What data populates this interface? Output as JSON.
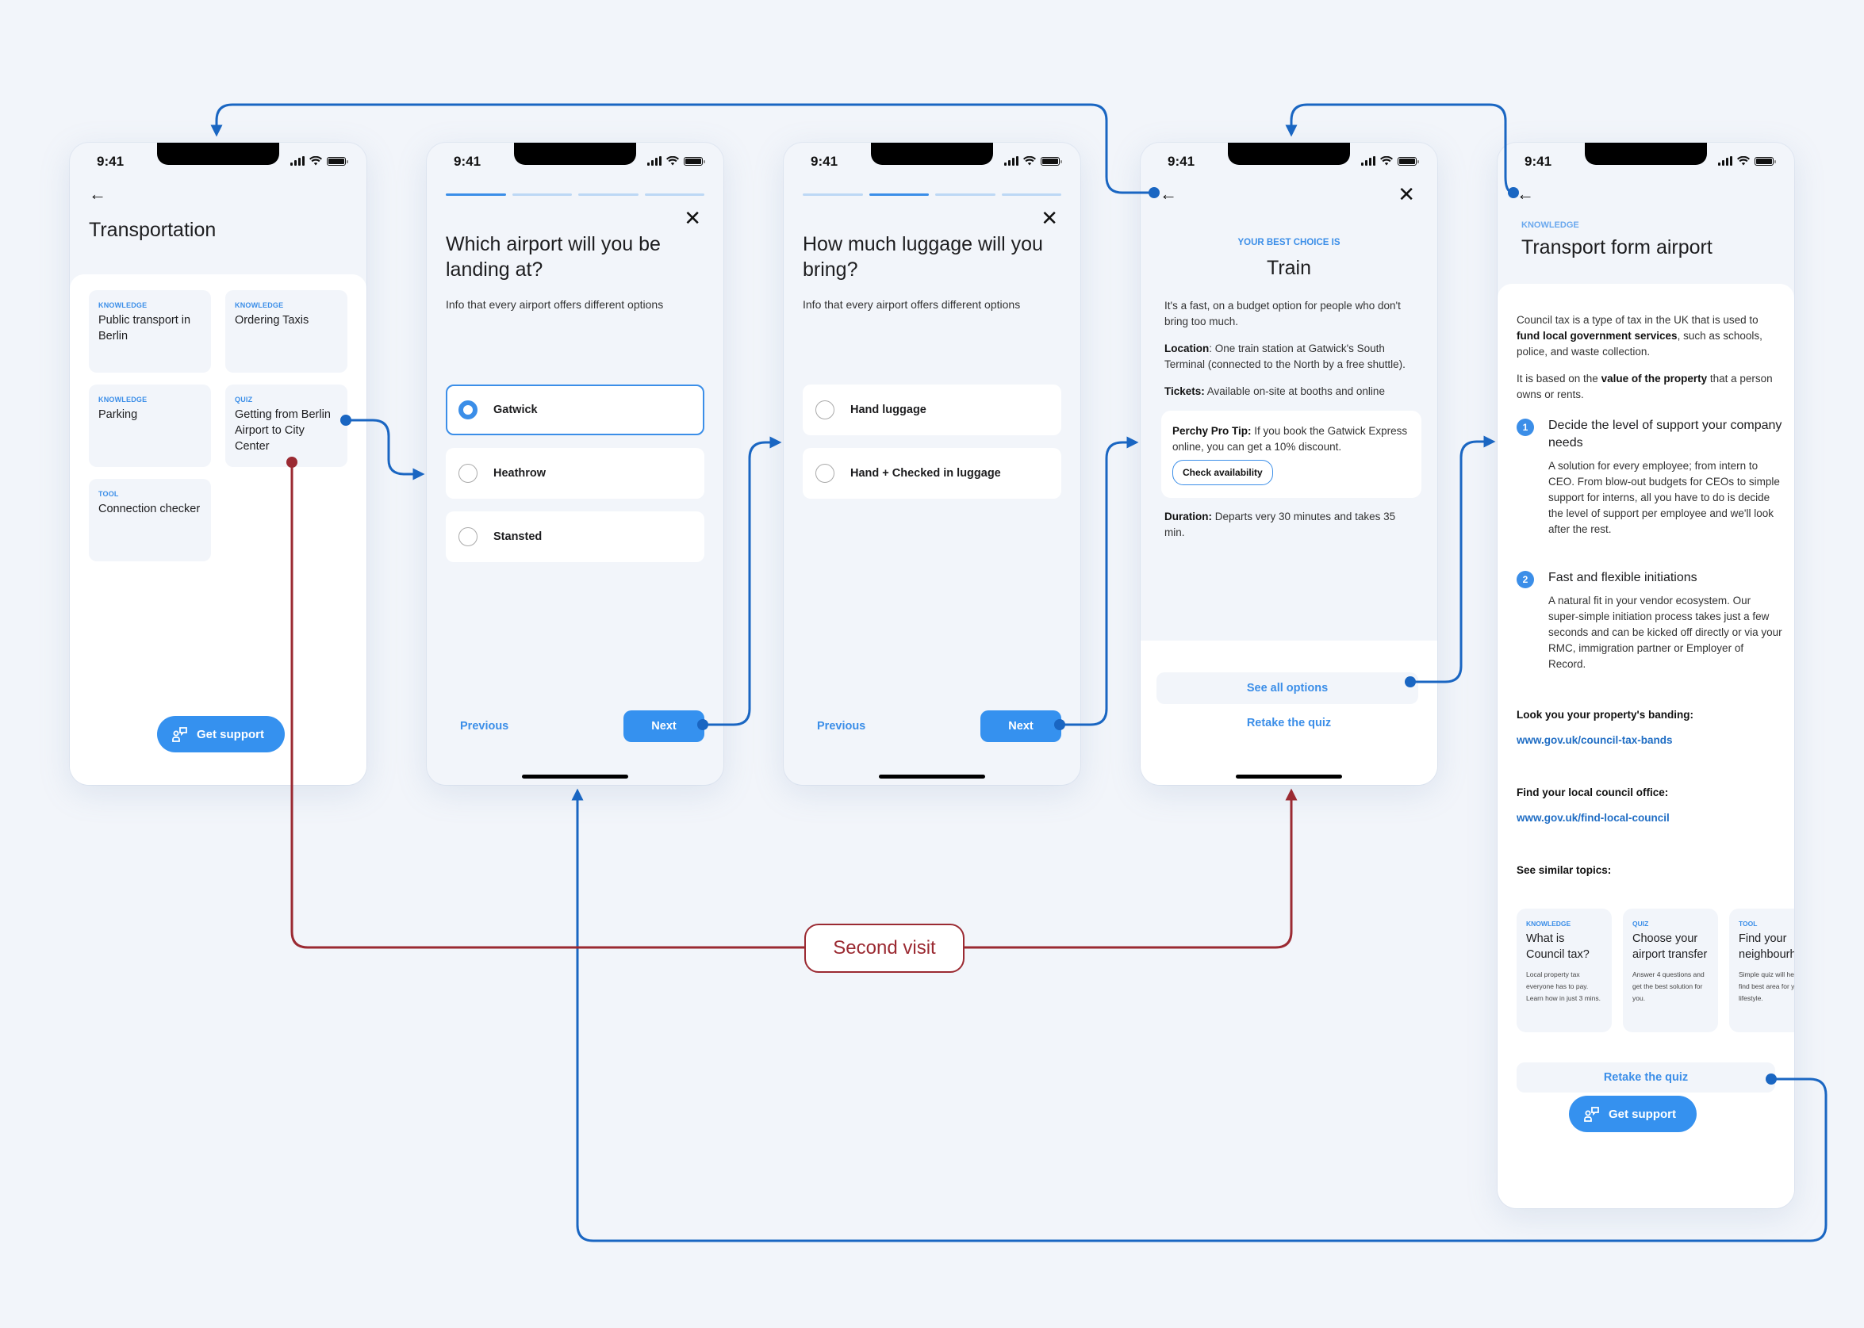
{
  "status_bar": {
    "time": "9:41"
  },
  "colors": {
    "accent": "#3591ef",
    "flow_blue": "#1a66c2",
    "flow_red": "#9b2a32",
    "background": "#f2f5fa"
  },
  "screen_home": {
    "back_icon": "arrow-left-icon",
    "title": "Transportation",
    "tiles": [
      {
        "tag": "KNOWLEDGE",
        "title": "Public transport in Berlin"
      },
      {
        "tag": "KNOWLEDGE",
        "title": "Ordering Taxis"
      },
      {
        "tag": "KNOWLEDGE",
        "title": "Parking"
      },
      {
        "tag": "QUIZ",
        "title": "Getting from Berlin Airport to City Center"
      },
      {
        "tag": "TOOL",
        "title": "Connection checker"
      }
    ],
    "support_button": "Get support"
  },
  "screen_quiz1": {
    "progress": {
      "step": 1,
      "total": 4
    },
    "question": "Which airport will you be landing at?",
    "subtitle": "Info that every airport offers different options",
    "options": [
      {
        "label": "Gatwick",
        "selected": true
      },
      {
        "label": "Heathrow",
        "selected": false
      },
      {
        "label": "Stansted",
        "selected": false
      }
    ],
    "previous": "Previous",
    "next": "Next"
  },
  "screen_quiz2": {
    "progress": {
      "step": 2,
      "total": 4
    },
    "question": "How much luggage will you bring?",
    "subtitle": "Info that every airport offers different options",
    "options": [
      {
        "label": "Hand luggage",
        "selected": false
      },
      {
        "label": "Hand + Checked in luggage",
        "selected": false
      }
    ],
    "previous": "Previous",
    "next": "Next"
  },
  "screen_result": {
    "eyebrow": "YOUR BEST CHOICE IS",
    "title": "Train",
    "intro": "It's a fast, on a budget option for people who don't bring too much.",
    "location_label": "Location",
    "location_text": ": One train station at Gatwick's South Terminal (connected to the North by a free shuttle).",
    "tickets_label": "Tickets:",
    "tickets_text": " Available on-site at booths and online",
    "tip_label": "Perchy Pro Tip:",
    "tip_text": " If you book the Gatwick Express online, you can get a 10% discount.",
    "tip_button": "Check availability",
    "duration_label": "Duration:",
    "duration_text": " Departs very 30 minutes and takes 35 min.",
    "see_all": "See all options",
    "retake": "Retake the quiz"
  },
  "screen_article": {
    "eyebrow": "KNOWLEDGE",
    "title": "Transport form airport",
    "p1_a": "Council tax is a type of tax in the UK that is used to ",
    "p1_b": "fund local government services",
    "p1_c": ", such as schools, police, and waste collection.",
    "p2_a": "It is based on the ",
    "p2_b": "value of the property",
    "p2_c": " that a person owns or rents.",
    "steps": [
      {
        "num": "1",
        "title": "Decide the level of support your company needs",
        "body": "A solution for every employee; from intern to CEO. From blow-out budgets for CEOs to simple support for interns, all you have to do is decide the level of support per employee and we'll look after the rest."
      },
      {
        "num": "2",
        "title": "Fast and flexible initiations",
        "body": "A natural fit in your vendor ecosystem. Our super-simple initiation process takes just a few seconds and can be kicked off directly or via your RMC, immigration partner or Employer of Record."
      }
    ],
    "banding_label": "Look you your property's banding:",
    "banding_link": "www.gov.uk/council-tax-bands",
    "council_label": "Find your local council office:",
    "council_link": "www.gov.uk/find-local-council",
    "similar_label": "See similar topics:",
    "topics": [
      {
        "tag": "KNOWLEDGE",
        "title": "What is Council tax?",
        "desc": "Local property tax everyone has to pay. Learn how in just 3 mins."
      },
      {
        "tag": "QUIZ",
        "title": "Choose your airport transfer",
        "desc": "Answer 4 questions and get the best solution for you."
      },
      {
        "tag": "TOOL",
        "title": "Find your neighbourhood",
        "desc": "Simple quiz will help you find best area for your lifestyle."
      }
    ],
    "retake": "Retake the quiz",
    "support_button": "Get support"
  },
  "annotation": {
    "second_visit": "Second visit"
  }
}
